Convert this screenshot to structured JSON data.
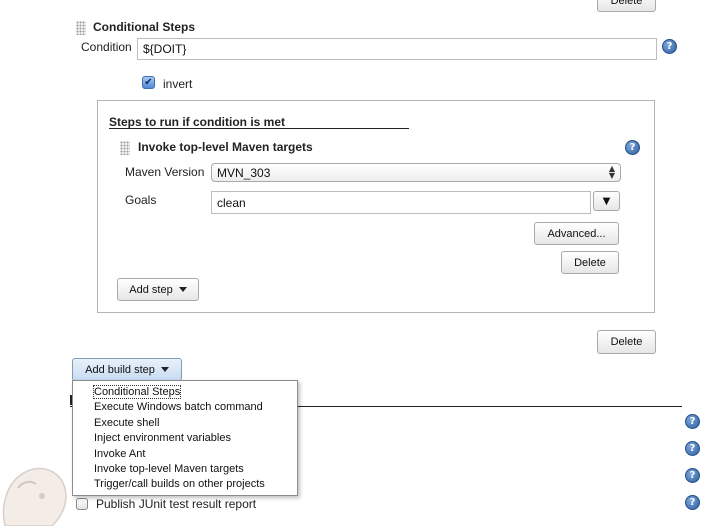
{
  "top_delete_label": "Delete",
  "conditional": {
    "title": "Conditional Steps",
    "condition_label": "Condition",
    "condition_value": "${DOIT}",
    "invert_label": "invert",
    "invert_checked": true
  },
  "steps_section": {
    "title": "Steps to run if condition is met",
    "maven": {
      "title": "Invoke top-level Maven targets",
      "version_label": "Maven Version",
      "version_value": "MVN_303",
      "goals_label": "Goals",
      "goals_value": "clean",
      "advanced_label": "Advanced...",
      "delete_label": "Delete"
    },
    "add_step_label": "Add step"
  },
  "outer_delete_label": "Delete",
  "add_build_step": {
    "label": "Add build step",
    "menu_items": [
      "Conditional Steps",
      "Execute Windows batch command",
      "Execute shell",
      "Inject environment variables",
      "Invoke Ant",
      "Invoke top-level Maven targets",
      "Trigger/call builds on other projects"
    ]
  },
  "post_build": {
    "publish_junit_label": "Publish JUnit test result report"
  },
  "icons": {
    "help": "?",
    "checkmark": "✔",
    "dropdown": "▼"
  },
  "colors": {
    "help_blue": "#2a5d9f",
    "menu_border": "#8c8c8c",
    "add_build_step_bg": "#dce9f7"
  }
}
